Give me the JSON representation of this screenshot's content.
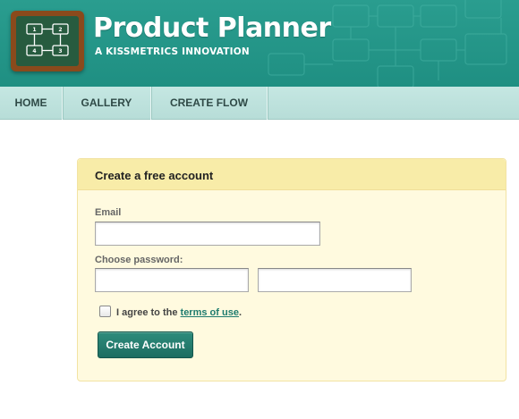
{
  "header": {
    "title": "Product Planner",
    "subtitle": "A KISSMETRICS INNOVATION",
    "logo_icon": "flowchart-board-icon",
    "logo_boxes": [
      "1",
      "2",
      "4",
      "3"
    ]
  },
  "nav": {
    "items": [
      {
        "label": "HOME"
      },
      {
        "label": "GALLERY"
      },
      {
        "label": "CREATE FLOW"
      }
    ]
  },
  "signup": {
    "title": "Create a free account",
    "email_label": "Email",
    "email_value": "",
    "password_label": "Choose password:",
    "password_value": "",
    "confirm_password_value": "",
    "agree_prefix": "I agree to the ",
    "terms_link": "terms of use",
    "agree_suffix": ".",
    "agree_checked": false,
    "submit_label": "Create Account"
  },
  "colors": {
    "header_teal": "#2a9d8f",
    "nav_bg": "#c5e7e2",
    "panel_bg": "#fffadf",
    "panel_head_bg": "#f8eca8",
    "button_bg": "#1d6d61",
    "link": "#1e7b6e"
  }
}
